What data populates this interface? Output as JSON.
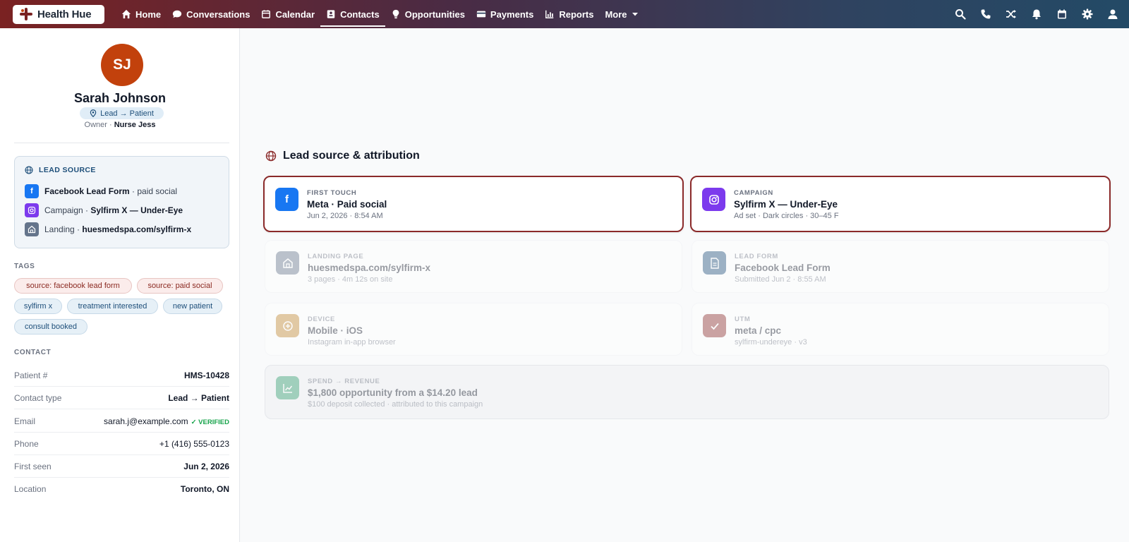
{
  "app": {
    "brand": "Health Hue"
  },
  "nav": {
    "home": "Home",
    "conversations": "Conversations",
    "calendar": "Calendar",
    "contacts": "Contacts",
    "opportunities": "Opportunities",
    "payments": "Payments",
    "reports": "Reports",
    "more": "More"
  },
  "top_icons": [
    "search-icon",
    "phone-icon",
    "shuffle-icon",
    "bell-icon",
    "calendar-icon",
    "gear-icon",
    "user-icon"
  ],
  "contact": {
    "initials": "SJ",
    "name": "Sarah Johnson",
    "status": "Lead → Patient",
    "owner_label": "Owner ·",
    "owner": "Nurse Jess"
  },
  "lead_source": {
    "title": "LEAD SOURCE",
    "form_name": "Facebook Lead Form",
    "form_suffix": "· paid social",
    "campaign_prefix": "Campaign ·",
    "campaign": "Sylfirm X — Under-Eye",
    "landing_prefix": "Landing ·",
    "landing": "huesmedspa.com/sylfirm-x"
  },
  "tags": {
    "title": "TAGS",
    "items": [
      "source: facebook lead form",
      "source: paid social",
      "sylfirm x",
      "treatment interested",
      "new patient",
      "consult booked"
    ]
  },
  "contact_info": {
    "title": "CONTACT",
    "rows": [
      {
        "k": "Patient #",
        "v": "HMS-10428"
      },
      {
        "k": "Contact type",
        "v": "Lead → Patient"
      },
      {
        "k": "Email",
        "v": "sarah.j@example.com",
        "badge": "✓ VERIFIED"
      },
      {
        "k": "Phone",
        "v": "+1 (416) 555-0123"
      },
      {
        "k": "First seen",
        "v": "Jun 2, 2026"
      },
      {
        "k": "Location",
        "v": "Toronto, ON"
      }
    ]
  },
  "attribution": {
    "title": "Lead source & attribution",
    "cards": [
      {
        "label": "FIRST TOUCH",
        "main": "Meta · Paid social",
        "sub": "Jun 2, 2026 · 8:54 AM",
        "icon": "facebook-icon",
        "color": "#1877f2"
      },
      {
        "label": "CAMPAIGN",
        "main": "Sylfirm X — Under-Eye",
        "sub": "Ad set · Dark circles · 30–45 F",
        "icon": "instagram-icon",
        "color": "#7c3aed"
      },
      {
        "label": "LANDING PAGE",
        "main": "huesmedspa.com/sylfirm-x",
        "sub": "3 pages · 4m 12s on site",
        "icon": "home-icon",
        "color": "#64748b"
      },
      {
        "label": "LEAD FORM",
        "main": "Facebook Lead Form",
        "sub": "Submitted Jun 2 · 8:55 AM",
        "icon": "document-icon",
        "color": "#1e4f7a"
      },
      {
        "label": "DEVICE",
        "main": "Mobile · iOS",
        "sub": "Instagram in-app browser",
        "icon": "plus-circle-icon",
        "color": "#c2862f"
      },
      {
        "label": "UTM",
        "main": "meta / cpc",
        "sub": "sylfirm-undereye · v3",
        "icon": "check-icon",
        "color": "#8b2a2a"
      },
      {
        "label": "SPEND → REVENUE",
        "main": "$1,800 opportunity from a $14.20 lead",
        "sub": "$100 deposit collected · attributed to this campaign",
        "icon": "chart-icon",
        "color": "#2f9e6e"
      }
    ]
  }
}
